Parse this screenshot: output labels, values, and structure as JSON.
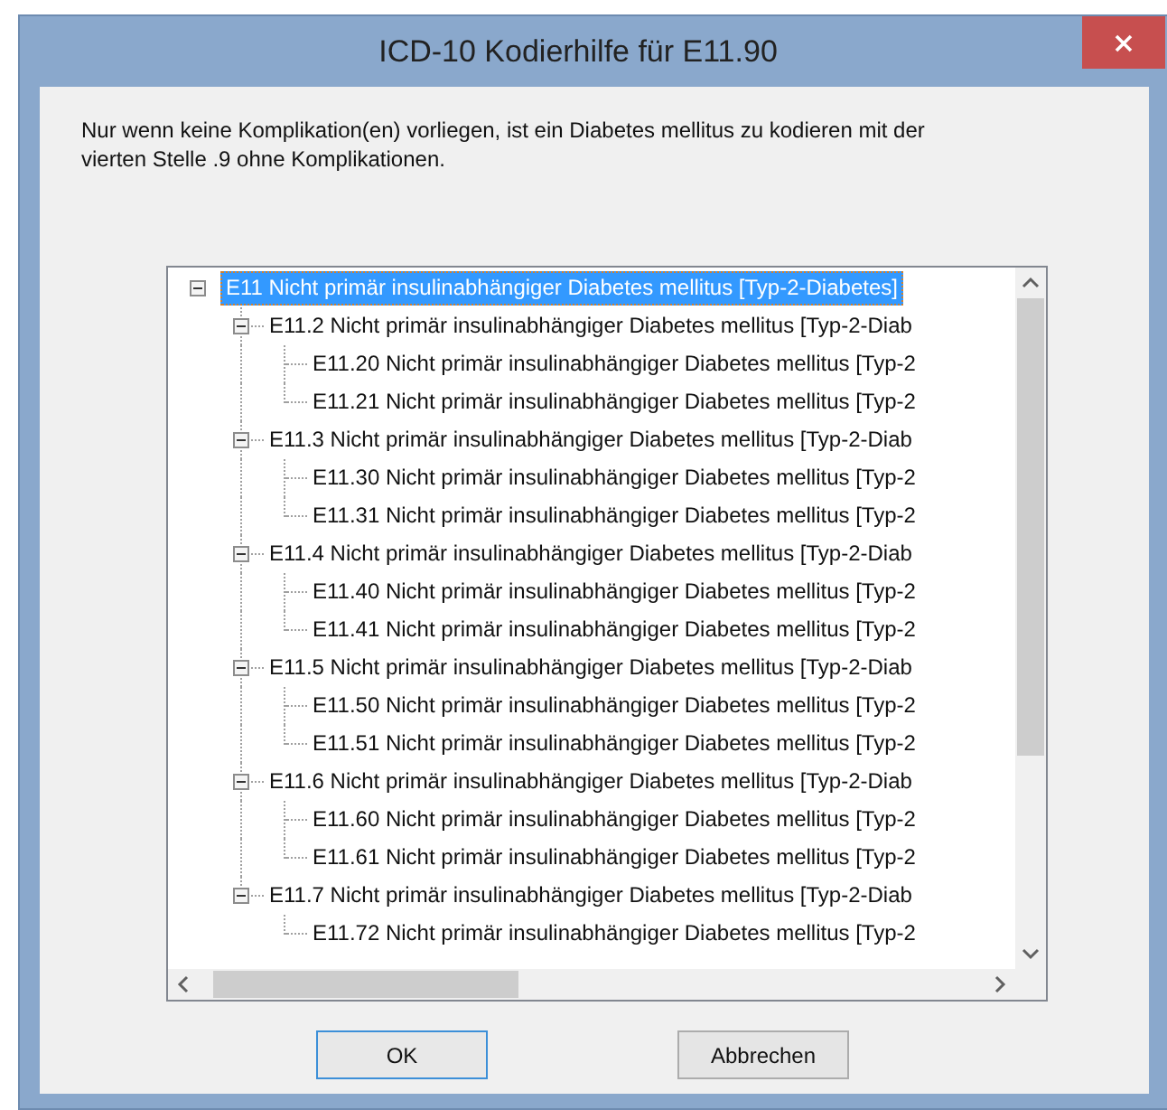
{
  "window": {
    "title": "ICD-10 Kodierhilfe für E11.90"
  },
  "message": "Nur wenn keine Komplikation(en) vorliegen, ist ein Diabetes mellitus zu kodieren mit der vierten Stelle .9 ohne Komplikationen.",
  "tree": [
    {
      "label": "E11 Nicht primär insulinabhängiger Diabetes mellitus [Typ-2-Diabetes]",
      "selected": true,
      "expanded": true,
      "children": [
        {
          "label": "E11.2 Nicht primär insulinabhängiger Diabetes mellitus [Typ-2-Diab",
          "selected": false,
          "expanded": true,
          "children": [
            {
              "label": "E11.20 Nicht primär insulinabhängiger Diabetes mellitus [Typ-2",
              "selected": false
            },
            {
              "label": "E11.21 Nicht primär insulinabhängiger Diabetes mellitus [Typ-2",
              "selected": false
            }
          ]
        },
        {
          "label": "E11.3 Nicht primär insulinabhängiger Diabetes mellitus [Typ-2-Diab",
          "selected": false,
          "expanded": true,
          "children": [
            {
              "label": "E11.30 Nicht primär insulinabhängiger Diabetes mellitus [Typ-2",
              "selected": false
            },
            {
              "label": "E11.31 Nicht primär insulinabhängiger Diabetes mellitus [Typ-2",
              "selected": false
            }
          ]
        },
        {
          "label": "E11.4 Nicht primär insulinabhängiger Diabetes mellitus [Typ-2-Diab",
          "selected": false,
          "expanded": true,
          "children": [
            {
              "label": "E11.40 Nicht primär insulinabhängiger Diabetes mellitus [Typ-2",
              "selected": false
            },
            {
              "label": "E11.41 Nicht primär insulinabhängiger Diabetes mellitus [Typ-2",
              "selected": false
            }
          ]
        },
        {
          "label": "E11.5 Nicht primär insulinabhängiger Diabetes mellitus [Typ-2-Diab",
          "selected": false,
          "expanded": true,
          "children": [
            {
              "label": "E11.50 Nicht primär insulinabhängiger Diabetes mellitus [Typ-2",
              "selected": false
            },
            {
              "label": "E11.51 Nicht primär insulinabhängiger Diabetes mellitus [Typ-2",
              "selected": false
            }
          ]
        },
        {
          "label": "E11.6 Nicht primär insulinabhängiger Diabetes mellitus [Typ-2-Diab",
          "selected": false,
          "expanded": true,
          "children": [
            {
              "label": "E11.60 Nicht primär insulinabhängiger Diabetes mellitus [Typ-2",
              "selected": false
            },
            {
              "label": "E11.61 Nicht primär insulinabhängiger Diabetes mellitus [Typ-2",
              "selected": false
            }
          ]
        },
        {
          "label": "E11.7 Nicht primär insulinabhängiger Diabetes mellitus [Typ-2-Diab",
          "selected": false,
          "expanded": true,
          "children": [
            {
              "label": "E11.72 Nicht primär insulinabhängiger Diabetes mellitus [Typ-2",
              "selected": false
            }
          ]
        }
      ]
    }
  ],
  "buttons": [
    {
      "label": "OK",
      "default": true
    },
    {
      "label": "Abbrechen",
      "default": false
    }
  ]
}
